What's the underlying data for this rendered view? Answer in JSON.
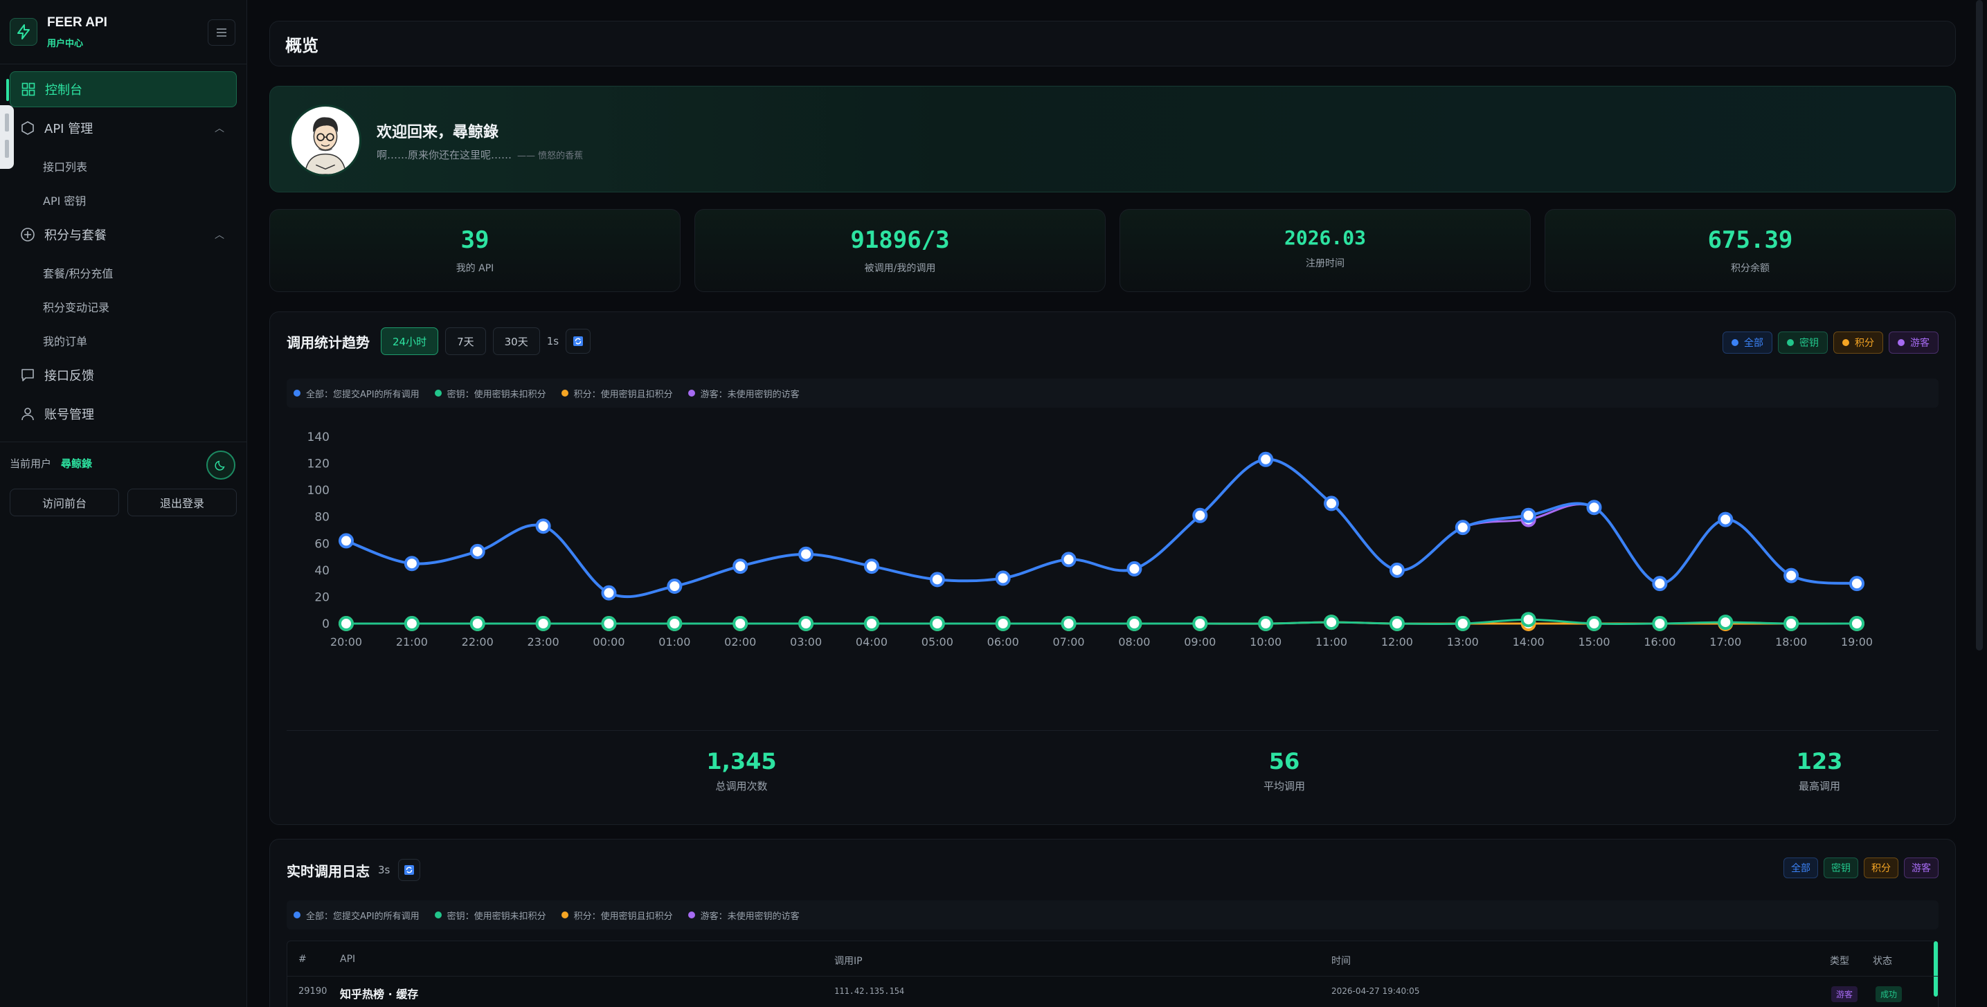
{
  "brand": {
    "title": "FEER API",
    "subtitle": "用户中心"
  },
  "nav": {
    "dashboard": "控制台",
    "api_mgmt": "API 管理",
    "api_list": "接口列表",
    "api_key": "API 密钥",
    "points": "积分与套餐",
    "recharge": "套餐/积分充值",
    "points_log": "积分变动记录",
    "orders": "我的订单",
    "feedback": "接口反馈",
    "account": "账号管理"
  },
  "user": {
    "label": "当前用户",
    "name": "尋鲸錄",
    "visit_front": "访问前台",
    "logout": "退出登录"
  },
  "page_title": "概览",
  "welcome": {
    "title": "欢迎回来，尋鲸錄",
    "quote": "啊……原来你还在这里呢……",
    "quote_author": "—— 愤怒的香蕉"
  },
  "stats": [
    {
      "value": "39",
      "label": "我的 API"
    },
    {
      "value": "91896/3",
      "label": "被调用/我的调用"
    },
    {
      "value": "2026.03",
      "label": "注册时间"
    },
    {
      "value": "675.39",
      "label": "积分余额"
    }
  ],
  "chart_panel": {
    "title": "调用统计趋势",
    "ranges": [
      "24小时",
      "7天",
      "30天"
    ],
    "interval": "1s",
    "tags": [
      "全部",
      "密钥",
      "积分",
      "游客"
    ],
    "legend": [
      {
        "text": "全部：您提交API的所有调用",
        "color": "#3b82f6"
      },
      {
        "text": "密钥：使用密钥未扣积分",
        "color": "#22c58b"
      },
      {
        "text": "积分：使用密钥且扣积分",
        "color": "#f5a524"
      },
      {
        "text": "游客：未使用密钥的访客",
        "color": "#a66bf2"
      }
    ],
    "summary": [
      {
        "value": "1,345",
        "label": "总调用次数"
      },
      {
        "value": "56",
        "label": "平均调用"
      },
      {
        "value": "123",
        "label": "最高调用"
      }
    ]
  },
  "chart_data": {
    "type": "line",
    "categories": [
      "20:00",
      "21:00",
      "22:00",
      "23:00",
      "00:00",
      "01:00",
      "02:00",
      "03:00",
      "04:00",
      "05:00",
      "06:00",
      "07:00",
      "08:00",
      "09:00",
      "10:00",
      "11:00",
      "12:00",
      "13:00",
      "14:00",
      "15:00",
      "16:00",
      "17:00",
      "18:00",
      "19:00"
    ],
    "ylim": [
      0,
      140
    ],
    "yticks": [
      0,
      20,
      40,
      60,
      80,
      100,
      120,
      140
    ],
    "grid": false,
    "series": [
      {
        "name": "全部",
        "color": "#3b82f6",
        "values": [
          62,
          45,
          54,
          73,
          23,
          28,
          43,
          52,
          43,
          33,
          34,
          48,
          41,
          81,
          123,
          90,
          40,
          72,
          81,
          87,
          30,
          78,
          36,
          30
        ]
      },
      {
        "name": "游客",
        "color": "#a66bf2",
        "values": [
          62,
          45,
          54,
          73,
          23,
          28,
          43,
          52,
          43,
          33,
          34,
          48,
          41,
          81,
          123,
          90,
          40,
          72,
          78,
          87,
          30,
          78,
          36,
          30
        ]
      },
      {
        "name": "积分",
        "color": "#f5a524",
        "values": [
          0,
          0,
          0,
          0,
          0,
          0,
          0,
          0,
          0,
          0,
          0,
          0,
          0,
          0,
          0,
          1,
          0,
          0,
          0,
          0,
          0,
          0,
          0,
          0
        ]
      },
      {
        "name": "密钥",
        "color": "#22c58b",
        "values": [
          0,
          0,
          0,
          0,
          0,
          0,
          0,
          0,
          0,
          0,
          0,
          0,
          0,
          0,
          0,
          1,
          0,
          0,
          3,
          0,
          0,
          1,
          0,
          0
        ]
      }
    ]
  },
  "log_panel": {
    "title": "实时调用日志",
    "interval": "3s",
    "tags": [
      "全部",
      "密钥",
      "积分",
      "游客"
    ],
    "headers": [
      "#",
      "API",
      "调用IP",
      "时间",
      "类型",
      "状态"
    ],
    "rows": [
      {
        "id": "29190",
        "api": "知乎热榜 · 缓存",
        "ip": "111.42.135.154",
        "time": "2026-04-27 19:40:05",
        "type": "游客",
        "status": "成功"
      }
    ]
  }
}
